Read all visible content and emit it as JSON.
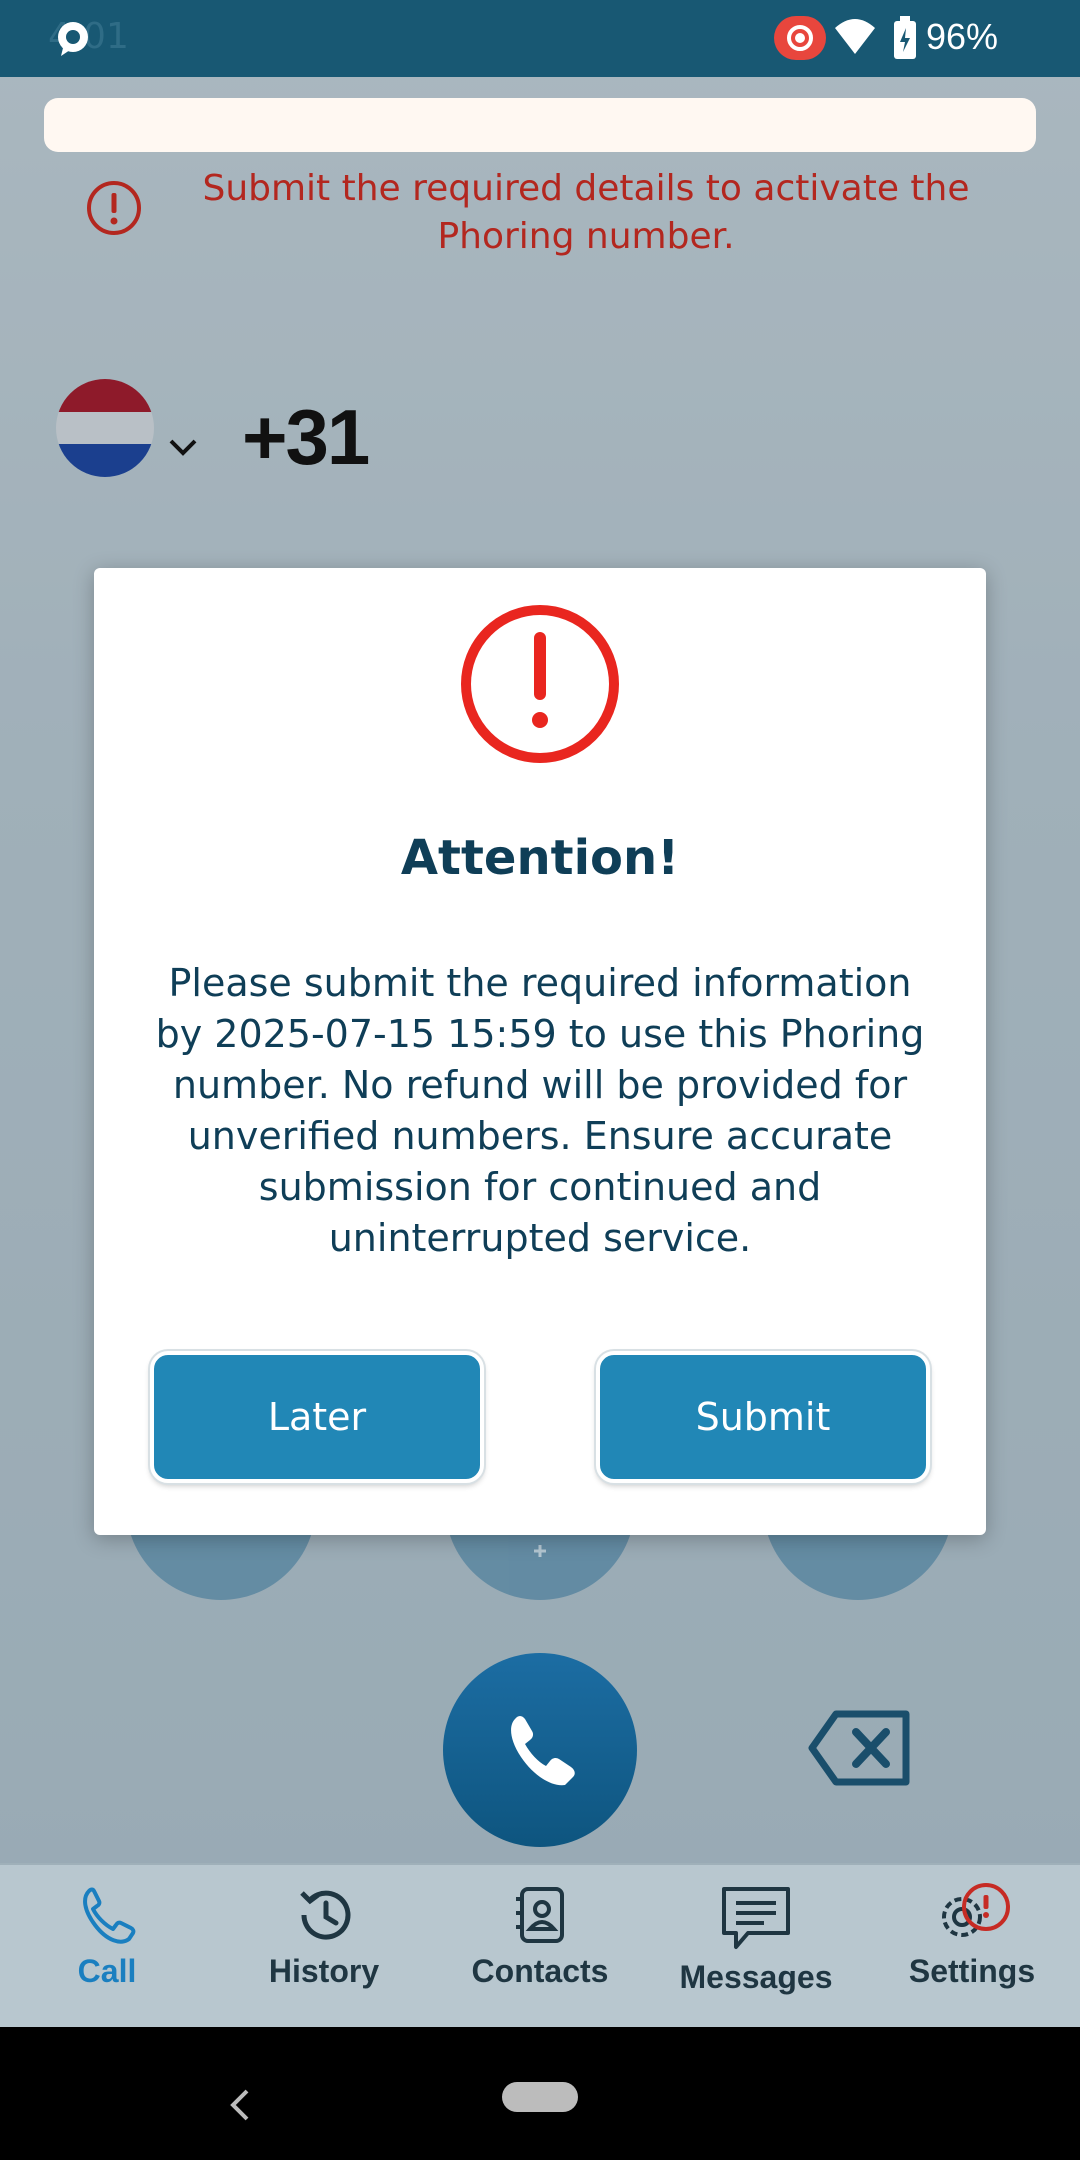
{
  "status_bar": {
    "time": "4:01",
    "battery": "96%"
  },
  "banner": {
    "warning_text": "Submit the required details to activate the Phoring number."
  },
  "dialer": {
    "dial_code": "+31",
    "country_flag": "netherlands-flag-icon"
  },
  "dialog": {
    "title": "Attention!",
    "message": "Please submit the required information by 2025-07-15 15:59 to use this Phoring number. No refund will be provided for unverified numbers. Ensure accurate submission for continued and uninterrupted service.",
    "later_label": "Later",
    "submit_label": "Submit"
  },
  "bottom_nav": {
    "items": [
      {
        "label": "Call",
        "icon": "phone-icon",
        "active": true
      },
      {
        "label": "History",
        "icon": "history-icon"
      },
      {
        "label": "Contacts",
        "icon": "contacts-icon"
      },
      {
        "label": "Messages",
        "icon": "messages-icon"
      },
      {
        "label": "Settings",
        "icon": "gear-icon"
      }
    ]
  },
  "colors": {
    "brand": "#2187b6",
    "status_bar": "#185873",
    "warning": "#b3271f",
    "alert_red": "#e9261f"
  }
}
